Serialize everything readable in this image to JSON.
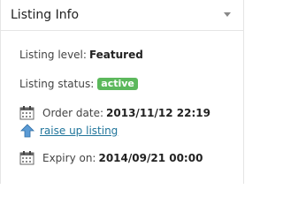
{
  "panel": {
    "title": "Listing Info",
    "toggle_icon": "collapse-arrow-icon"
  },
  "listing_level": {
    "label": "Listing level:",
    "value": "Featured"
  },
  "listing_status": {
    "label": "Listing status:",
    "value": "active",
    "badge_color": "#5cb85c"
  },
  "order_date": {
    "icon": "calendar-icon",
    "label": "Order date:",
    "value": "2013/11/12 22:19"
  },
  "raise_up": {
    "icon": "up-arrow-icon",
    "link_text": "raise up listing",
    "link_color": "#21759b"
  },
  "expiry": {
    "icon": "calendar-icon",
    "label": "Expiry on:",
    "value": "2014/09/21 00:00"
  }
}
